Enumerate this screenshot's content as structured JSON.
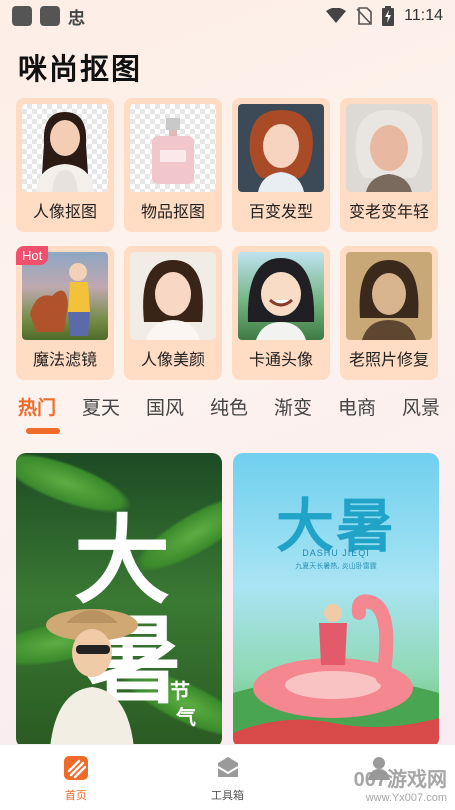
{
  "status_bar": {
    "time": "11:14",
    "left_glyph": "忠",
    "icons": [
      "wifi-icon",
      "no-sim-icon",
      "battery-charging-icon"
    ]
  },
  "app": {
    "title": "咪尚抠图"
  },
  "tools": [
    {
      "label": "人像抠图",
      "icon": "portrait-cutout"
    },
    {
      "label": "物品抠图",
      "icon": "object-cutout"
    },
    {
      "label": "百变发型",
      "icon": "hairstyle"
    },
    {
      "label": "变老变年轻",
      "icon": "age-change"
    },
    {
      "label": "魔法滤镜",
      "icon": "magic-filter",
      "badge": "Hot"
    },
    {
      "label": "人像美颜",
      "icon": "beauty"
    },
    {
      "label": "卡通头像",
      "icon": "cartoon-avatar"
    },
    {
      "label": "老照片修复",
      "icon": "photo-restore"
    }
  ],
  "tabs": [
    "热门",
    "夏天",
    "国风",
    "纯色",
    "渐变",
    "电商",
    "风景"
  ],
  "active_tab": "热门",
  "cards": {
    "left": {
      "chars": [
        "大",
        "暑"
      ],
      "side_chars": [
        "节",
        "气"
      ]
    },
    "right": {
      "title": "大暑",
      "subtitle": "DASHU JIEQI",
      "tagline": "九夏天长暑热, 炎山卧雷霆"
    }
  },
  "bottom_nav": [
    {
      "label": "首页",
      "icon": "home-icon",
      "active": true
    },
    {
      "label": "工具箱",
      "icon": "toolbox-icon",
      "active": false
    },
    {
      "label": "",
      "icon": "profile-icon",
      "active": false
    }
  ],
  "watermark": {
    "main": "007游戏网",
    "sub": "www.Yx007.com"
  },
  "colors": {
    "accent": "#f06a2a",
    "card_bg": "#ffdcc3",
    "hot_badge": "#f0506e"
  }
}
